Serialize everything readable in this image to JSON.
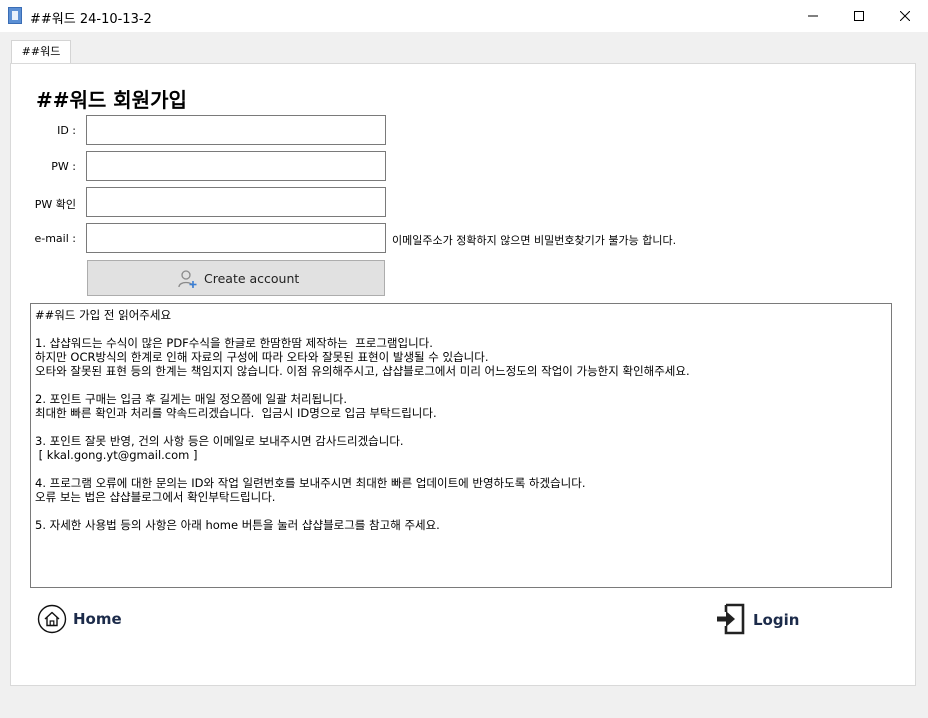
{
  "window": {
    "title": "##워드 24-10-13-2"
  },
  "tabs": [
    {
      "label": "##워드"
    }
  ],
  "form": {
    "heading": "##워드 회원가입",
    "id_label": "ID :",
    "pw_label": "PW :",
    "pw_confirm_label": "PW 확인",
    "email_label": "e-mail :",
    "id_value": "",
    "pw_value": "",
    "pw_confirm_value": "",
    "email_value": "",
    "email_note": "이메일주소가 정확하지 않으면 비밀번호찾기가 불가능 합니다.",
    "create_button": "Create account"
  },
  "notice": {
    "lines": [
      "##워드 가입 전 읽어주세요",
      "",
      "1. 샵샵워드는 수식이 많은 PDF수식을 한글로 한땀한땀 제작하는  프로그램입니다.",
      "하지만 OCR방식의 한계로 인해 자료의 구성에 따라 오타와 잘못된 표현이 발생될 수 있습니다.",
      "오타와 잘못된 표현 등의 한계는 책임지지 않습니다. 이점 유의해주시고, 샵샵블로그에서 미리 어느정도의 작업이 가능한지 확인해주세요.",
      "",
      "2. 포인트 구매는 입금 후 길게는 매일 정오쯤에 일괄 처리됩니다.",
      "최대한 빠른 확인과 처리를 약속드리겠습니다.  입금시 ID명으로 입금 부탁드립니다.",
      "",
      "3. 포인트 잘못 반영, 건의 사항 등은 이메일로 보내주시면 감사드리겠습니다.",
      " [ kkal.gong.yt@gmail.com ]",
      "",
      "4. 프로그램 오류에 대한 문의는 ID와 작업 일련번호를 보내주시면 최대한 빠른 업데이트에 반영하도록 하겠습니다.",
      "오류 보는 법은 샵샵블로그에서 확인부탁드립니다.",
      "",
      "5. 자세한 사용법 등의 사항은 아래 home 버튼을 눌러 샵샵블로그를 참고해 주세요."
    ]
  },
  "footer": {
    "home_label": "Home",
    "login_label": "Login"
  },
  "icons": {
    "app": "app-icon",
    "minimize": "minimize-icon",
    "maximize": "maximize-icon",
    "close": "close-icon",
    "create": "add-user-icon",
    "home": "home-icon",
    "login": "login-icon"
  }
}
